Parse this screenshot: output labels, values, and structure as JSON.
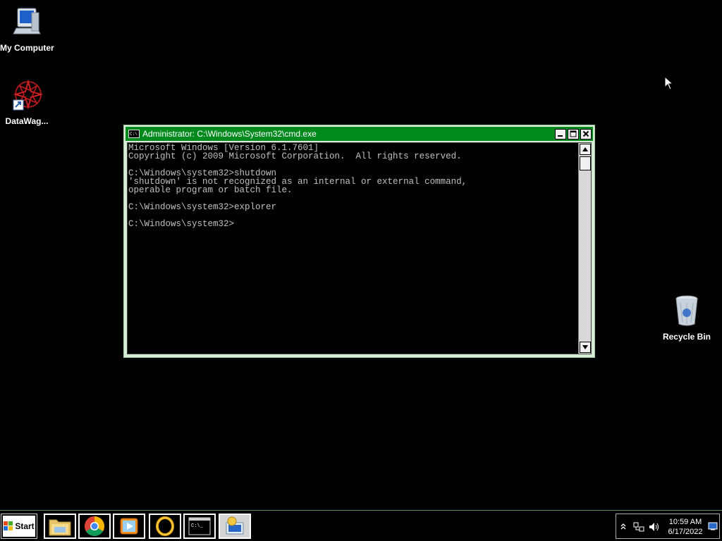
{
  "desktop": {
    "icons": [
      {
        "label": "My Computer"
      },
      {
        "label": "DataWag..."
      },
      {
        "label": "Recycle Bin"
      }
    ]
  },
  "cmd_window": {
    "title": "Administrator: C:\\Windows\\System32\\cmd.exe",
    "console_text": "Microsoft Windows [Version 6.1.7601]\nCopyright (c) 2009 Microsoft Corporation.  All rights reserved.\n\nC:\\Windows\\system32>shutdown\n'shutdown' is not recognized as an internal or external command,\noperable program or batch file.\n\nC:\\Windows\\system32>explorer\n\nC:\\Windows\\system32>"
  },
  "taskbar": {
    "start_label": "Start",
    "apps": [
      "file-explorer-icon",
      "chrome-icon",
      "media-player-icon",
      "ring-app-icon",
      "cmd-icon",
      "remote-desktop-icon"
    ],
    "clock": {
      "time": "10:59 AM",
      "date": "6/17/2022"
    }
  },
  "colors": {
    "titlebar": "#008a1e",
    "window_frame": "#d6ecd6",
    "console_text": "#c0c0c0"
  }
}
